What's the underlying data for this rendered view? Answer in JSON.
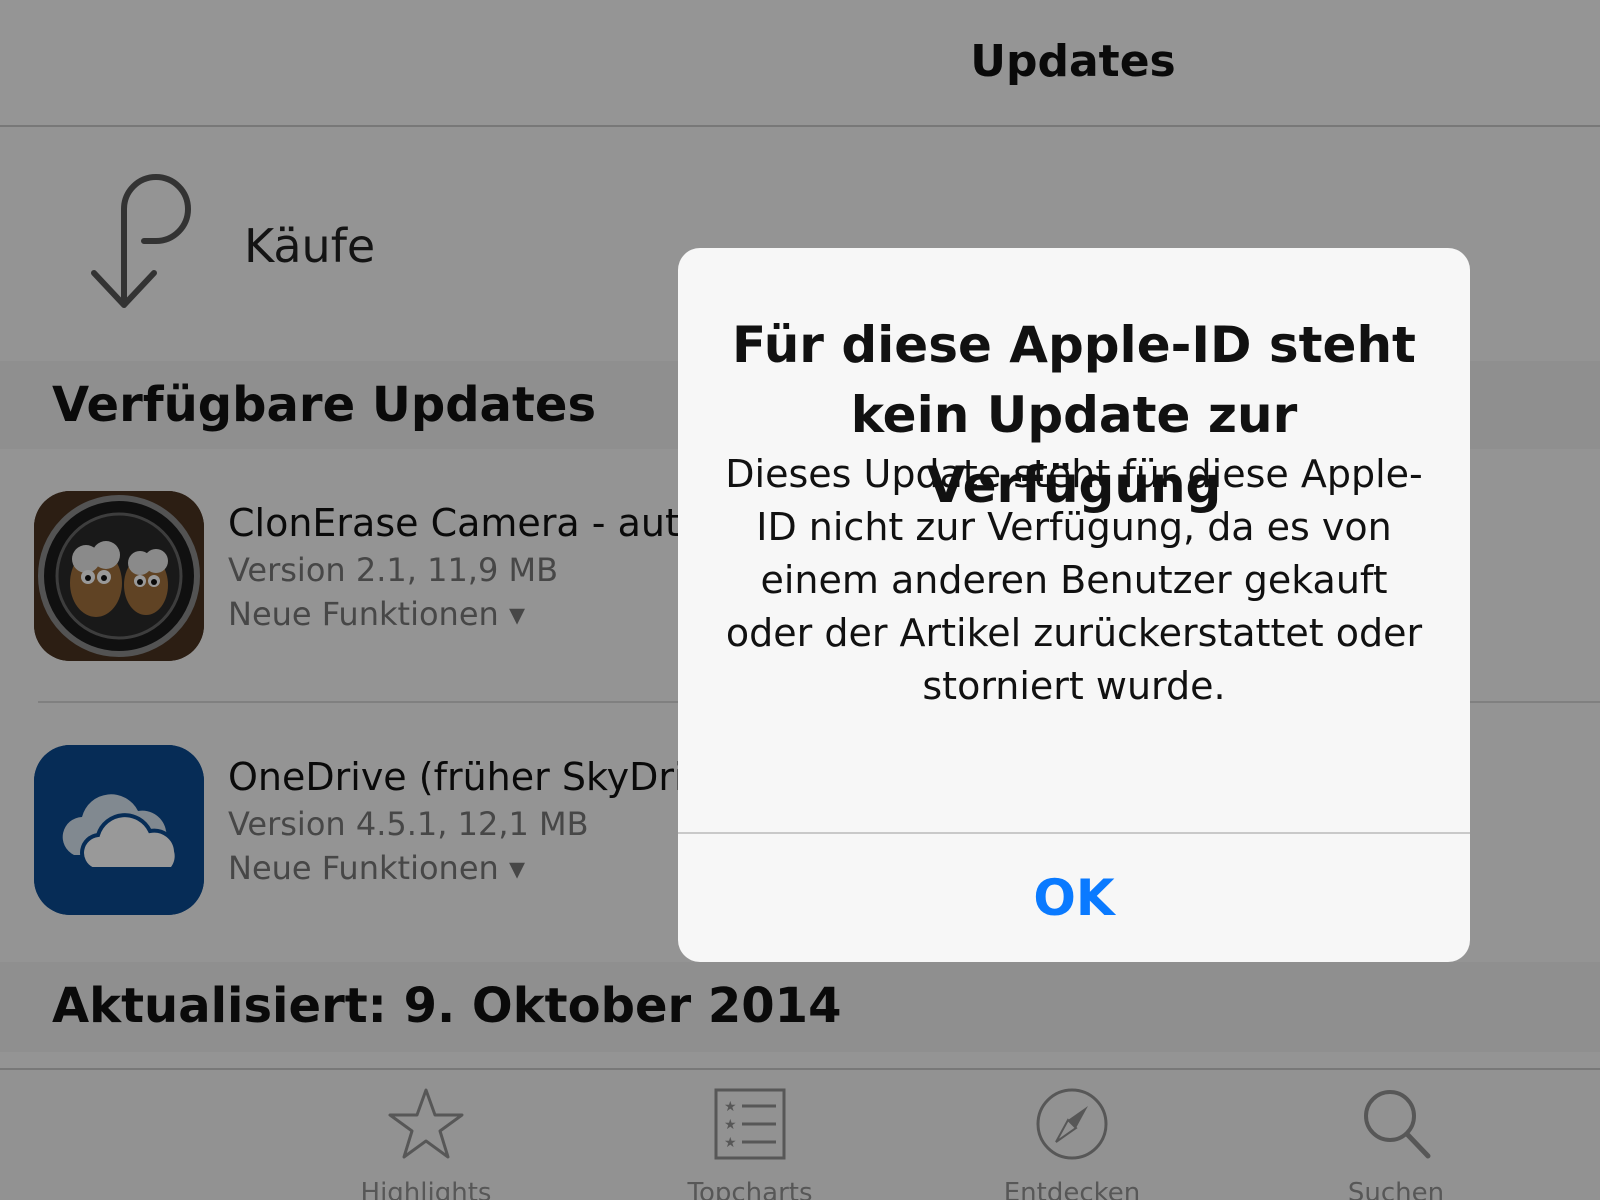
{
  "navbar": {
    "title": "Updates"
  },
  "purchases": {
    "label": "Käufe",
    "icon": "purchases-arrow-icon"
  },
  "available_updates": {
    "header": "Verfügbare Updates",
    "apps": [
      {
        "name": "ClonErase Camera - aut",
        "version": "Version 2.1, 11,9 MB",
        "news": "Neue Funktionen ▾",
        "icon": "clonerase-camera-app-icon"
      },
      {
        "name": "OneDrive (früher SkyDriv",
        "version": "Version 4.5.1, 12,1 MB",
        "news": "Neue Funktionen ▾",
        "icon": "onedrive-app-icon"
      }
    ]
  },
  "updated_section": {
    "header": "Aktualisiert: 9. Oktober 2014"
  },
  "tabbar": {
    "tabs": [
      {
        "label": "Highlights",
        "icon": "star-icon"
      },
      {
        "label": "Topcharts",
        "icon": "list-icon"
      },
      {
        "label": "Entdecken",
        "icon": "compass-icon"
      },
      {
        "label": "Suchen",
        "icon": "search-icon"
      }
    ]
  },
  "alert": {
    "title": "Für diese Apple-ID steht kein Update zur Verfügung",
    "message": "Dieses Update steht für diese Apple-ID nicht zur Verfügung, da es von einem anderen Benutzer gekauft oder der Artikel zurückerstattet oder storniert wurde.",
    "ok_label": "OK"
  },
  "colors": {
    "accent": "#0a7aff",
    "onedrive_blue": "#0b4a8f"
  }
}
